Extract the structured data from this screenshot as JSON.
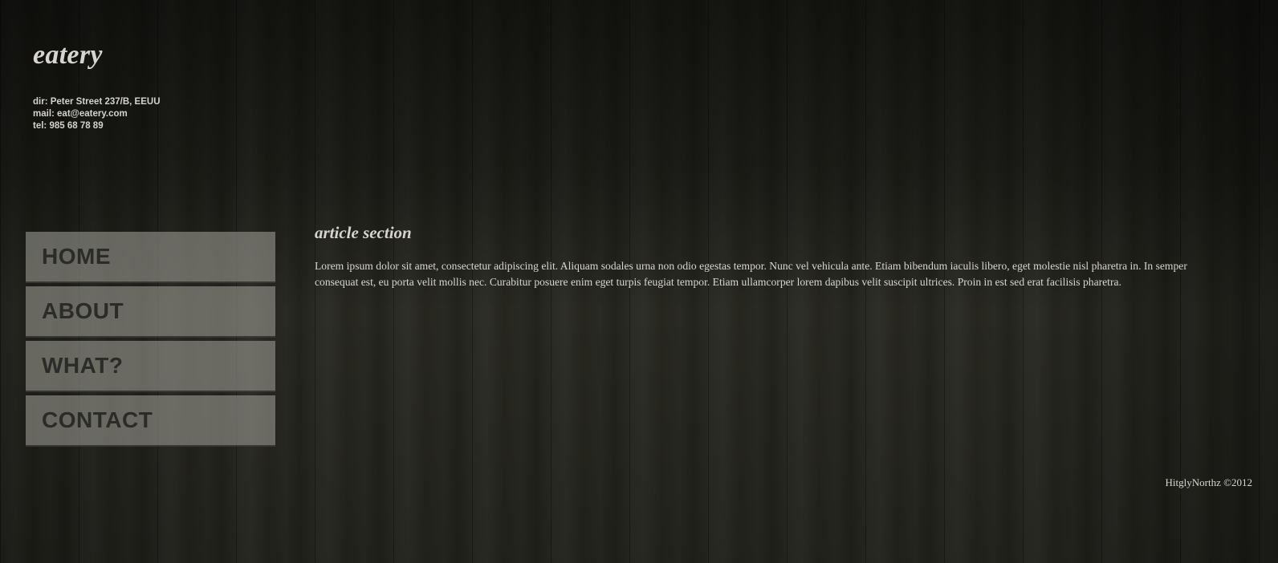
{
  "header": {
    "brand": "eatery",
    "address": "dir: Peter Street 237/B, EEUU",
    "mail": "mail: eat@eatery.com",
    "tel": "tel: 985 68 78 89"
  },
  "nav": {
    "items": [
      {
        "label": "HOME"
      },
      {
        "label": "ABOUT"
      },
      {
        "label": "WHAT?"
      },
      {
        "label": "CONTACT"
      }
    ]
  },
  "article": {
    "title": "article section",
    "body": "Lorem ipsum dolor sit amet, consectetur adipiscing elit. Aliquam sodales urna non odio egestas tempor. Nunc vel vehicula ante. Etiam bibendum iaculis libero, eget molestie nisl pharetra in. In semper consequat est, eu porta velit mollis nec. Curabitur posuere enim eget turpis feugiat tempor. Etiam ullamcorper lorem dapibus velit suscipit ultrices. Proin in est sed erat facilisis pharetra."
  },
  "footer": {
    "copyright": "HitglyNorthz ©2012"
  },
  "colors": {
    "background": "#2a2a24",
    "nav_button": "#8f8f87",
    "nav_text": "#2b2b28",
    "text": "#d8d6d0"
  }
}
